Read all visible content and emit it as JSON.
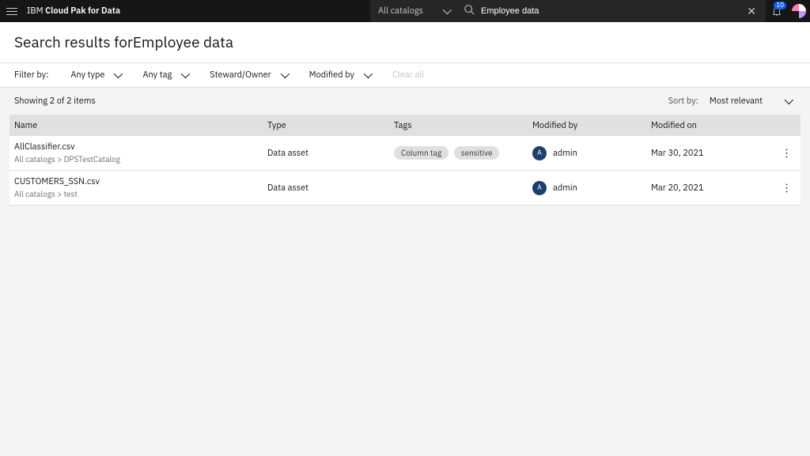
{
  "header": {
    "brand_prefix": "IBM ",
    "brand_bold": "Cloud Pak for Data",
    "catalog_selector": "All catalogs",
    "search_value": "Employee data",
    "notification_count": "10"
  },
  "title": {
    "prefix": "Search results for",
    "query": "Employee data"
  },
  "filters": {
    "label": "Filter by:",
    "type": "Any type",
    "tag": "Any tag",
    "steward": "Steward/Owner",
    "modified_by": "Modified by",
    "clear": "Clear all"
  },
  "meta": {
    "count_text": "Showing 2 of 2 items",
    "sort_label": "Sort by:",
    "sort_value": "Most relevant"
  },
  "columns": {
    "name": "Name",
    "type": "Type",
    "tags": "Tags",
    "modified_by": "Modified by",
    "modified_on": "Modified on"
  },
  "rows": [
    {
      "name": "AllClassifier.csv",
      "breadcrumb": "All catalogs > DPSTestCatalog",
      "type": "Data asset",
      "tags": [
        "Column tag",
        "sensitive"
      ],
      "modified_by_initial": "A",
      "modified_by": "admin",
      "modified_on": "Mar 30, 2021"
    },
    {
      "name": "CUSTOMERS_SSN.csv",
      "breadcrumb": "All catalogs > test",
      "type": "Data asset",
      "tags": [],
      "modified_by_initial": "A",
      "modified_by": "admin",
      "modified_on": "Mar 20, 2021"
    }
  ]
}
